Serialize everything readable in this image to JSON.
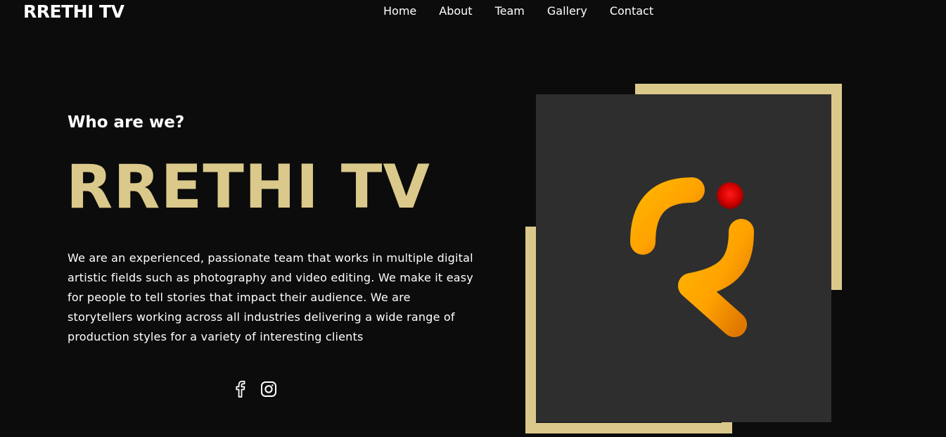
{
  "header": {
    "brand": "RRETHI TV",
    "nav": [
      "Home",
      "About",
      "Team",
      "Gallery",
      "Contact"
    ]
  },
  "hero": {
    "eyebrow": "Who are we?",
    "title": "RRETHI TV",
    "description": "We are an experienced, passionate team that works in multiple digital artistic fields such as photography and video editing. We make it easy for people to tell stories that impact their audience. We are storytellers working across all industries delivering a wide range of production styles for a variety of interesting clients"
  },
  "social": {
    "icons": [
      "facebook-icon",
      "instagram-icon"
    ]
  },
  "colors": {
    "background": "#0c0c0c",
    "accent_gold": "#dac98a",
    "logo_box": "#2e2e2e",
    "logo_orange": "#ffa500",
    "logo_red_dot": "#e00000"
  }
}
